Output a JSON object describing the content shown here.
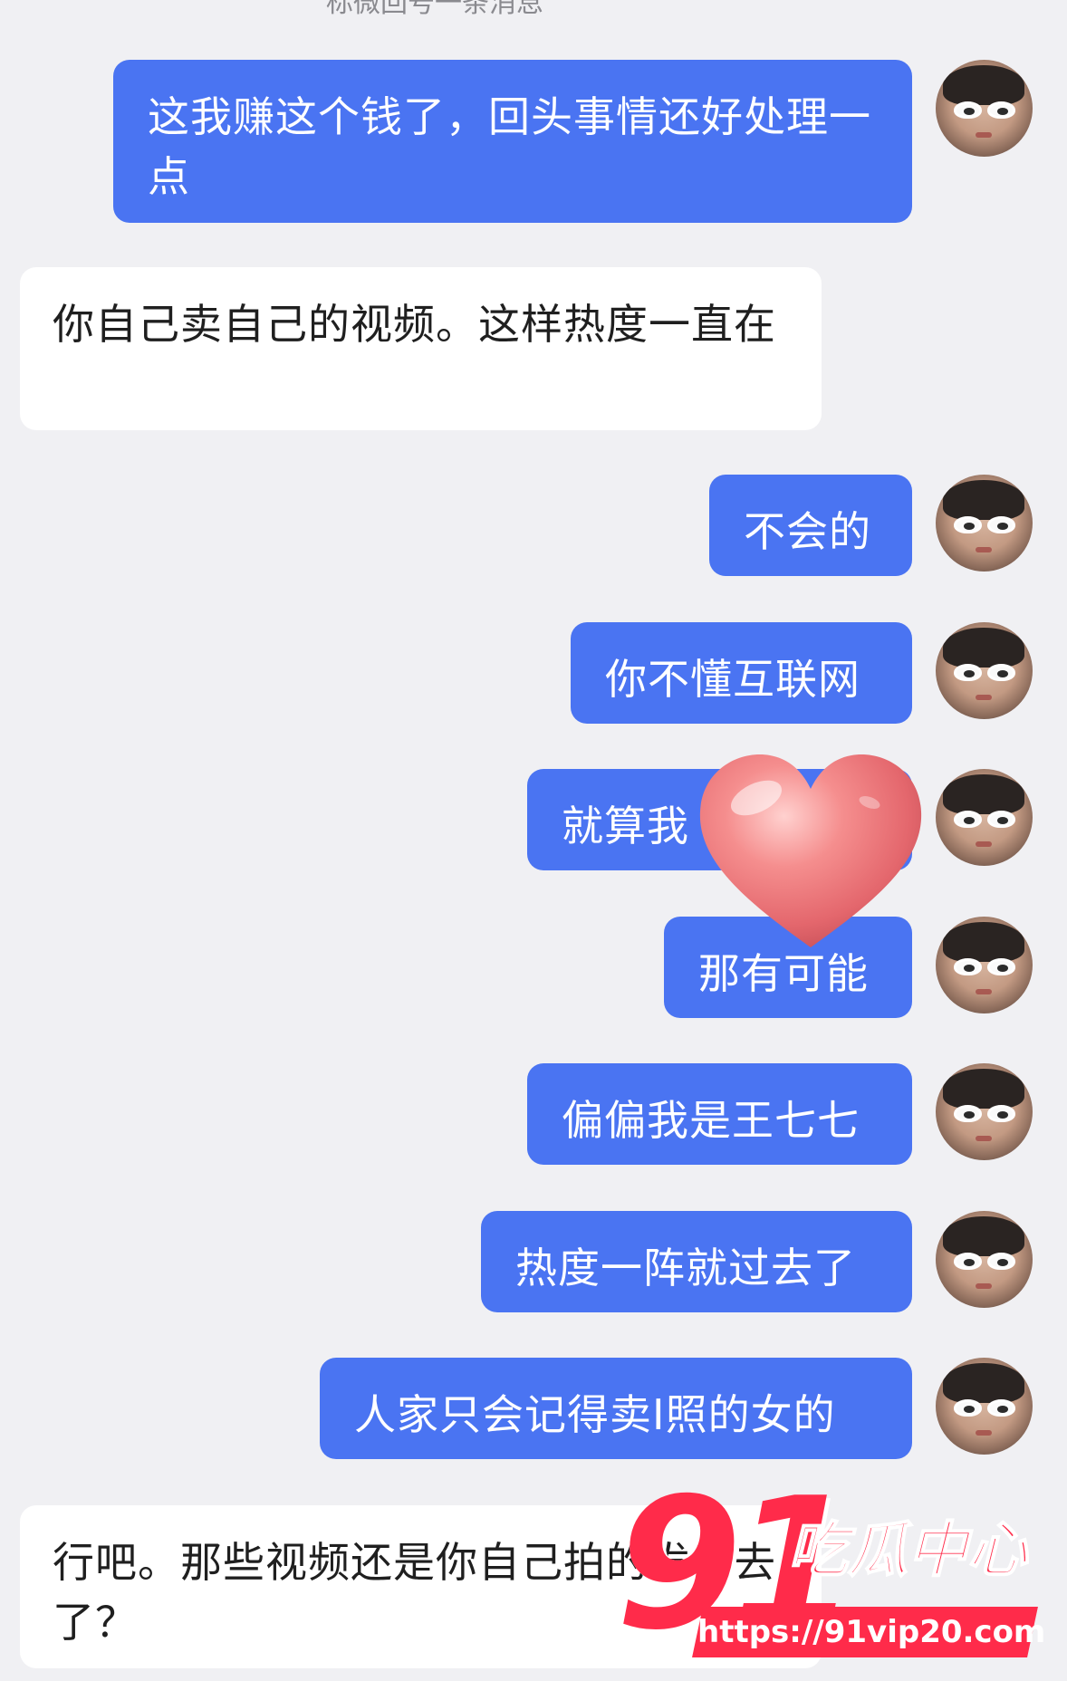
{
  "header": {
    "partial_text": "标微回号一条消息"
  },
  "messages": [
    {
      "side": "out",
      "text": "这我赚这个钱了，回头事情还好处理一点"
    },
    {
      "side": "in",
      "text": "你自己卖自己的视频。这样热度一直在"
    },
    {
      "side": "out",
      "text": "不会的"
    },
    {
      "side": "out",
      "text": "你不懂互联网"
    },
    {
      "side": "out",
      "text": "就算我"
    },
    {
      "side": "out",
      "text": "那有可能"
    },
    {
      "side": "out",
      "text": "偏偏我是王七七"
    },
    {
      "side": "out",
      "text": "热度一阵就过去了"
    },
    {
      "side": "out",
      "text": "人家只会记得卖I照的女的"
    },
    {
      "side": "in",
      "text": "行吧。那些视频还是你自己拍的发出去了？"
    }
  ],
  "overlay": {
    "sticker": "heart-sticker"
  },
  "watermark": {
    "number": "91",
    "title": "吃瓜中心",
    "url": "https://91vip20.com"
  },
  "colors": {
    "outgoing_bubble": "#4a74f2",
    "incoming_bubble": "#ffffff",
    "background": "#f0f0f3",
    "watermark": "#ff2b4a"
  }
}
